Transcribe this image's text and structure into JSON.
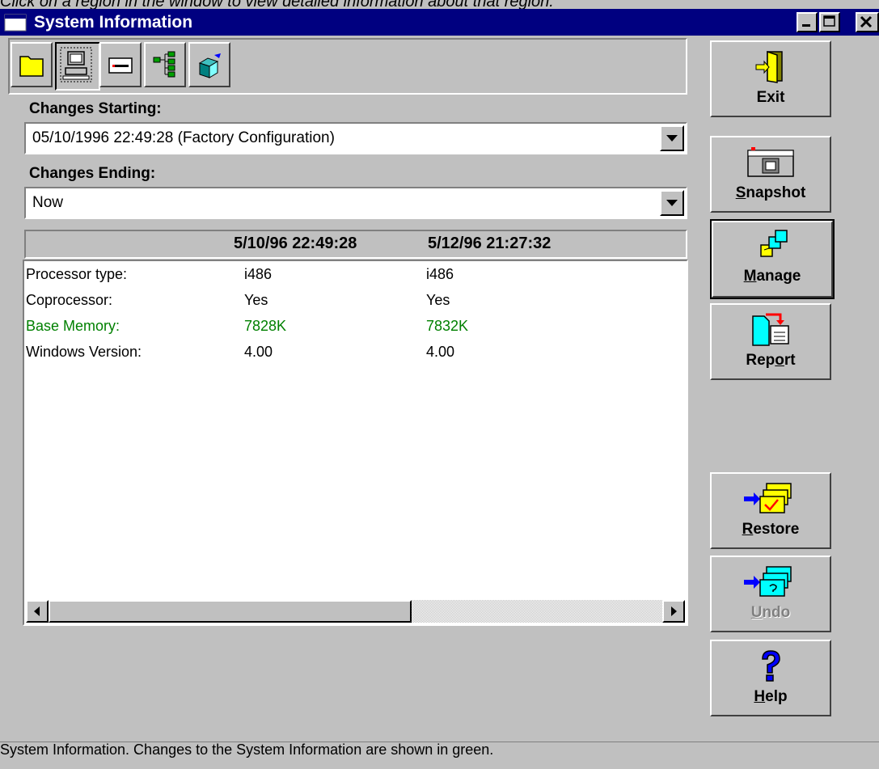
{
  "caption": "Click on a region in the window to view detailed information about that region.",
  "window": {
    "title": "System Information"
  },
  "toolbar": {
    "buttons": [
      {
        "icon": "folder-icon"
      },
      {
        "icon": "computer-icon",
        "pressed": true
      },
      {
        "icon": "hardware-card-icon"
      },
      {
        "icon": "tree-icon"
      },
      {
        "icon": "3d-cube-icon"
      }
    ]
  },
  "changes_starting": {
    "label": "Changes Starting:",
    "value": "05/10/1996 22:49:28 (Factory Configuration)"
  },
  "changes_ending": {
    "label": "Changes Ending:",
    "value": "Now"
  },
  "columns": {
    "first": "5/10/96  22:49:28",
    "second": "5/12/96  21:27:32"
  },
  "rows": [
    {
      "label": "Processor type:",
      "first": "i486",
      "second": "i486",
      "changed": false
    },
    {
      "label": "Coprocessor:",
      "first": "Yes",
      "second": "Yes",
      "changed": false
    },
    {
      "label": "Base Memory:",
      "first": "7828K",
      "second": "7832K",
      "changed": true
    },
    {
      "label": "Windows Version:",
      "first": "4.00",
      "second": "4.00",
      "changed": false
    }
  ],
  "colors": {
    "changed": "#008000",
    "title_bar": "#000080",
    "face": "#c0c0c0"
  },
  "buttons": {
    "exit": {
      "pre": "",
      "mnemonic": "",
      "post": "Exit"
    },
    "snapshot": {
      "pre": "",
      "mnemonic": "S",
      "post": "napshot"
    },
    "manage": {
      "pre": "",
      "mnemonic": "M",
      "post": "anage"
    },
    "report": {
      "pre": "Rep",
      "mnemonic": "o",
      "post": "rt"
    },
    "restore": {
      "pre": "",
      "mnemonic": "R",
      "post": "estore"
    },
    "undo": {
      "pre": "",
      "mnemonic": "U",
      "post": "ndo",
      "disabled": true
    },
    "help": {
      "pre": "",
      "mnemonic": "H",
      "post": "elp"
    }
  },
  "status": {
    "text": "System Information.  Changes to the System Information are shown in green."
  }
}
